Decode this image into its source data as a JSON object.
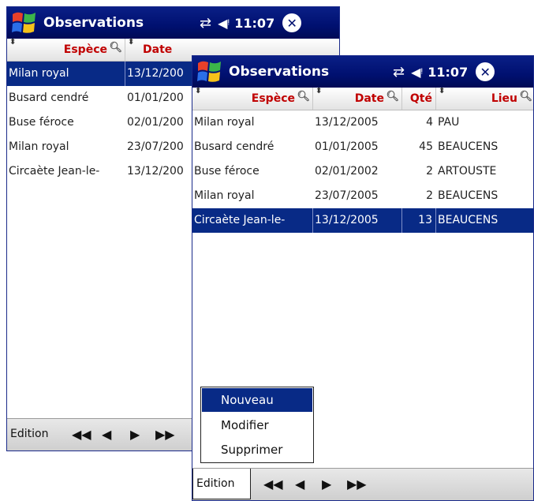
{
  "colors": {
    "title_bar": "#001070",
    "selection": "#082a86",
    "header_text": "#c00000",
    "menu_bar": "#d8d8d8"
  },
  "status": {
    "time": "11:07",
    "connectivity_icon": "connectivity-icon",
    "volume_icon": "speaker-icon"
  },
  "back_window": {
    "title": "Observations",
    "columns": [
      "Espèce",
      "Date"
    ],
    "rows": [
      {
        "espece": "Milan royal",
        "date": "13/12/200"
      },
      {
        "espece": "Busard cendré",
        "date": "01/01/200"
      },
      {
        "espece": "Buse féroce",
        "date": "02/01/200"
      },
      {
        "espece": "Milan royal",
        "date": "23/07/200"
      },
      {
        "espece": "Circaète Jean-le-",
        "date": "13/12/200"
      }
    ],
    "selected_row": 0,
    "menu": {
      "edition": "Edition"
    }
  },
  "front_window": {
    "title": "Observations",
    "columns": [
      "Espèce",
      "Date",
      "Qté",
      "Lieu"
    ],
    "rows": [
      {
        "espece": "Milan royal",
        "date": "13/12/2005",
        "qte": "4",
        "lieu": "PAU"
      },
      {
        "espece": "Busard cendré",
        "date": "01/01/2005",
        "qte": "45",
        "lieu": "BEAUCENS"
      },
      {
        "espece": "Buse féroce",
        "date": "02/01/2002",
        "qte": "2",
        "lieu": "ARTOUSTE"
      },
      {
        "espece": "Milan royal",
        "date": "23/07/2005",
        "qte": "2",
        "lieu": "BEAUCENS"
      },
      {
        "espece": "Circaète Jean-le-",
        "date": "13/12/2005",
        "qte": "13",
        "lieu": "BEAUCENS"
      }
    ],
    "selected_row": 4,
    "menu": {
      "edition": "Edition"
    }
  },
  "popup_menu": {
    "items": [
      "Nouveau",
      "Modifier",
      "Supprimer"
    ],
    "highlighted": 0
  }
}
